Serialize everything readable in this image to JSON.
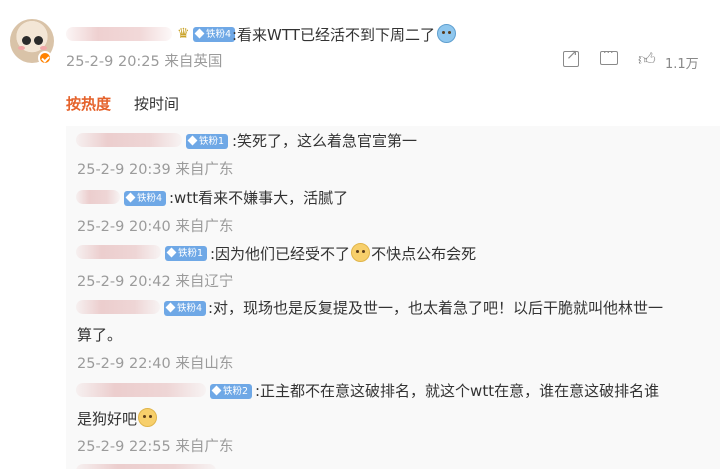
{
  "top_comment": {
    "avatar_icon": "user-avatar",
    "verified_icon": "verified-badge-icon",
    "crown_icon": "crown-icon",
    "fan_badge": "铁粉4",
    "text": ":看来WTT已经活不到下周二了",
    "emoji": "cry-emoji",
    "time": "25-2-9 20:25",
    "location": "来自英国",
    "share_icon": "share-icon",
    "comment_icon": "comment-icon",
    "like_icon": "like-icon",
    "like_count": "1.1万"
  },
  "sort_tabs": [
    {
      "label": "按热度",
      "active": true
    },
    {
      "label": "按时间",
      "active": false
    }
  ],
  "replies": [
    {
      "fan_badge": "铁粉1",
      "text": ":笑死了，这么着急官宣第一",
      "time": "25-2-9 20:39",
      "location": "来自广东"
    },
    {
      "fan_badge": "铁粉4",
      "text": ":wtt看来不嫌事大，活腻了",
      "time": "25-2-9 20:40",
      "location": "来自广东"
    },
    {
      "fan_badge": "铁粉1",
      "text": ":因为他们已经受不了",
      "text_after_emoji": "不快点公布会死",
      "emoji": "dog-emoji",
      "time": "25-2-9 20:42",
      "location": "来自辽宁"
    },
    {
      "fan_badge": "铁粉4",
      "text": ":对，现场也是反复提及世一，也太着急了吧！以后干脆就叫他林世一",
      "text_line2": "算了。",
      "time": "25-2-9 22:40",
      "location": "来自山东"
    },
    {
      "fan_badge": "铁粉2",
      "text": ":正主都不在意这破排名，就这个wtt在意，谁在意这破排名谁",
      "text_line2": "是狗好吧",
      "emoji": "dog-emoji",
      "time": "25-2-9 22:55",
      "location": "来自广东"
    }
  ],
  "colors": {
    "accent": "#e5632c",
    "fan_badge": "#6fa8e6",
    "meta": "#9b9b9b",
    "reply_bg": "#f9f9f9"
  }
}
